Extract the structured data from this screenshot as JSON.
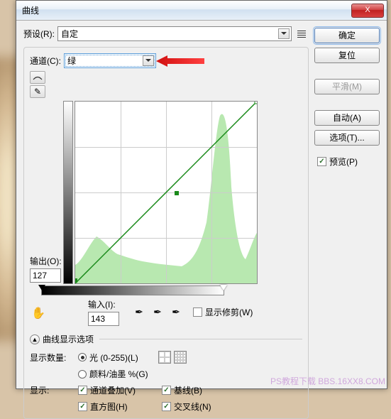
{
  "title": "曲线",
  "preset": {
    "label": "预设(R):",
    "value": "自定"
  },
  "channel": {
    "label": "通道(C):",
    "value": "绿"
  },
  "output": {
    "label": "输出(O):",
    "value": "127"
  },
  "input": {
    "label": "输入(I):",
    "value": "143"
  },
  "show_clipping": "显示修剪(W)",
  "expand_label": "曲线显示选项",
  "display_amount": {
    "label": "显示数量:",
    "opt1": "光 (0-255)(L)",
    "opt2": "颜料/油墨 %(G)"
  },
  "display": {
    "label": "显示:",
    "opt1": "通道叠加(V)",
    "opt2": "基线(B)",
    "opt3": "直方图(H)",
    "opt4": "交叉线(N)"
  },
  "buttons": {
    "ok": "确定",
    "reset": "复位",
    "smooth": "平滑(M)",
    "auto": "自动(A)",
    "options": "选项(T)..."
  },
  "preview": "预览(P)",
  "watermark": "PS教程下载\nBBS.16XX8.COM"
}
